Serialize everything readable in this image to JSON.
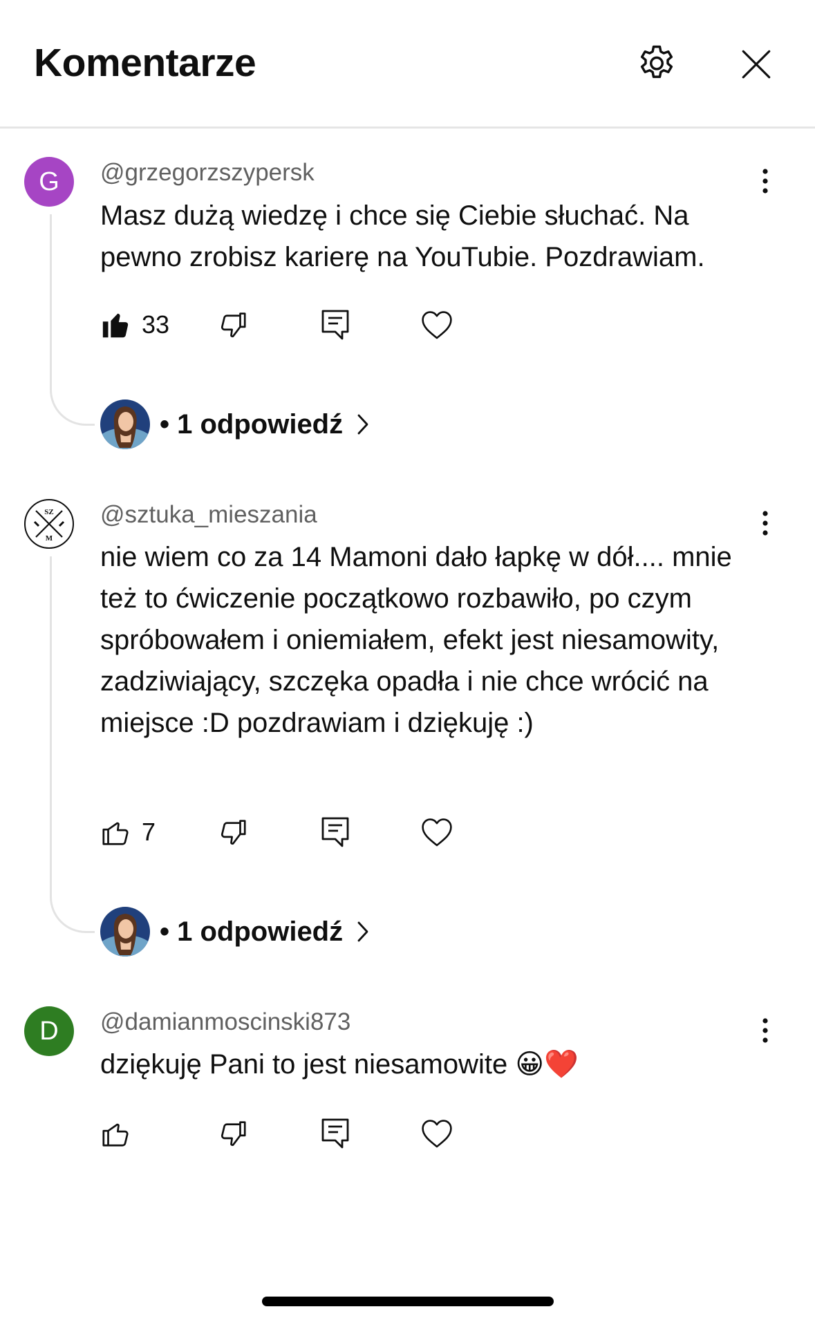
{
  "header": {
    "title": "Komentarze",
    "settings_icon": "gear-icon",
    "close_icon": "close-icon"
  },
  "comments": [
    {
      "author": "@grzegorzszypersk",
      "avatar_letter": "G",
      "avatar_color": "#a645c4",
      "text": "Masz dużą wiedzę i chce się Ciebie słuchać. Na pewno zrobisz karierę na YouTubie. Pozdrawiam.",
      "likes": "33",
      "liked": true,
      "replies_label": "• 1 odpowiedź"
    },
    {
      "author": "@sztuka_mieszania",
      "avatar_letter": "",
      "avatar_logo_text": "SZ M",
      "text": "nie wiem co za 14 Mamoni dało łapkę w dół.... mnie też to ćwiczenie początkowo rozbawiło, po czym spróbowałem i oniemiałem, efekt jest niesamowity, zadziwiający, szczęka opadła i nie chce wrócić na miejsce :D pozdrawiam i dziękuję :)",
      "likes": "7",
      "liked": false,
      "replies_label": "• 1 odpowiedź"
    },
    {
      "author": "@damianmoscinski873",
      "avatar_letter": "D",
      "avatar_color": "#2e7d22",
      "text": "dziękuję Pani to jest niesamowite 😀❤️",
      "likes": "",
      "liked": false
    }
  ]
}
